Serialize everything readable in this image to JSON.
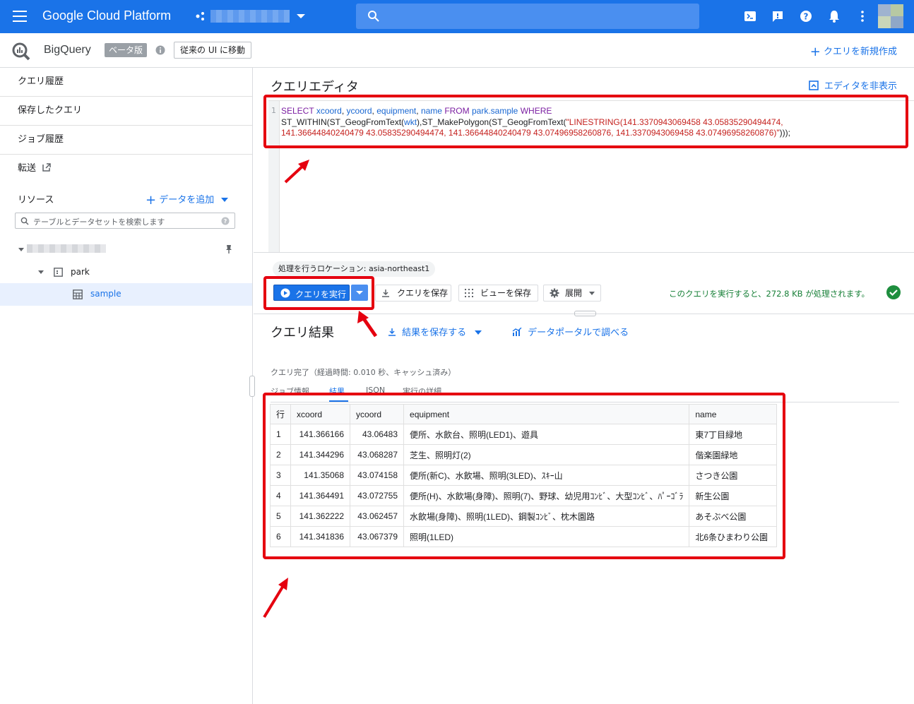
{
  "header": {
    "brand": "Google Cloud Platform",
    "project_name": ""
  },
  "subbar": {
    "product": "BigQuery",
    "beta_badge": "ベータ版",
    "legacy_ui_button": "従来の UI に移動",
    "new_query_button": "クエリを新規作成"
  },
  "sidebar": {
    "nav": [
      "クエリ履歴",
      "保存したクエリ",
      "ジョブ履歴",
      "転送"
    ],
    "resources_label": "リソース",
    "add_data_button": "データを追加",
    "search_placeholder": "テーブルとデータセットを検索します",
    "dataset": "park",
    "table": "sample"
  },
  "editor": {
    "title": "クエリエディタ",
    "hide_button": "エディタを非表示",
    "line_number": "1",
    "query_line1": "SELECT xcoord, ycoord, equipment, name FROM park.sample WHERE",
    "query_line2": "ST_WITHIN(ST_GeogFromText(wkt),ST_MakePolygon(ST_GeogFromText(\"LINESTRING(141.3370943069458 43.05835290494474,",
    "query_line3": "141.36644840240479 43.05835290494474, 141.36644840240479 43.07496958260876, 141.3370943069458 43.07496958260876)\")));"
  },
  "toolbar": {
    "location": "処理を行うロケーション: asia-northeast1",
    "run_button": "クエリを実行",
    "save_query": "クエリを保存",
    "save_view": "ビューを保存",
    "expand": "展開",
    "estimate": "このクエリを実行すると、272.8 KB が処理されます。"
  },
  "results": {
    "title": "クエリ結果",
    "save_results": "結果を保存する",
    "explore": "データポータルで調べる",
    "status": "クエリ完了（経過時間: 0.010 秒、キャッシュ済み）",
    "tabs": [
      "ジョブ情報",
      "結果",
      "JSON",
      "実行の詳細"
    ],
    "columns": [
      "行",
      "xcoord",
      "ycoord",
      "equipment",
      "name"
    ],
    "rows": [
      [
        "1",
        "141.366166",
        "43.06483",
        "便所、水飲台、照明(LED1)、遊具",
        "東7丁目緑地"
      ],
      [
        "2",
        "141.344296",
        "43.068287",
        "芝生、照明灯(2)",
        "偕楽園緑地"
      ],
      [
        "3",
        "141.35068",
        "43.074158",
        "便所(新C)、水飲場、照明(3LED)、ｽｷｰ山",
        "さつき公園"
      ],
      [
        "4",
        "141.364491",
        "43.072755",
        "便所(H)、水飲場(身障)、照明(7)、野球、幼児用ｺﾝﾋﾞ、大型ｺﾝﾋﾞ、ﾊﾟｰｺﾞﾗ",
        "新生公園"
      ],
      [
        "5",
        "141.362222",
        "43.062457",
        "水飲場(身障)、照明(1LED)、鋼製ｺﾝﾋﾞ、枕木園路",
        "あそぶべ公園"
      ],
      [
        "6",
        "141.341836",
        "43.067379",
        "照明(1LED)",
        "北6条ひまわり公園"
      ]
    ]
  },
  "colors": {
    "primary": "#1a73e8",
    "annotation_red": "#e5000f",
    "success": "#188038"
  }
}
